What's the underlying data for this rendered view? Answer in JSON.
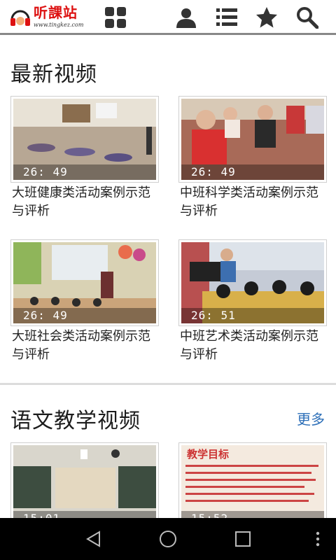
{
  "header": {
    "logo_text": "听課站",
    "logo_url": "www.tingkez.com",
    "icons": [
      "grid-icon",
      "user-icon",
      "list-icon",
      "star-icon",
      "search-icon"
    ]
  },
  "sections": [
    {
      "title": "最新视频",
      "more_label": "",
      "videos": [
        {
          "title": "大班健康类活动案例示范与评析",
          "duration": "26: 49"
        },
        {
          "title": "中班科学类活动案例示范与评析",
          "duration": "26: 49"
        },
        {
          "title": "大班社会类活动案例示范与评析",
          "duration": "26: 49"
        },
        {
          "title": "中班艺术类活动案例示范与评析",
          "duration": "26: 51"
        }
      ]
    },
    {
      "title": "语文教学视频",
      "more_label": "更多",
      "videos": [
        {
          "title": "",
          "duration": "15:01"
        },
        {
          "title": "",
          "duration": "15:52",
          "thumb_heading": "教学目标"
        }
      ]
    }
  ],
  "system_nav": {
    "buttons": [
      "back-icon",
      "home-icon",
      "recents-icon",
      "overflow-menu-icon"
    ]
  },
  "colors": {
    "logo_red": "#dd1111",
    "link_blue": "#2d6fb8",
    "nav_bg": "#000000"
  }
}
